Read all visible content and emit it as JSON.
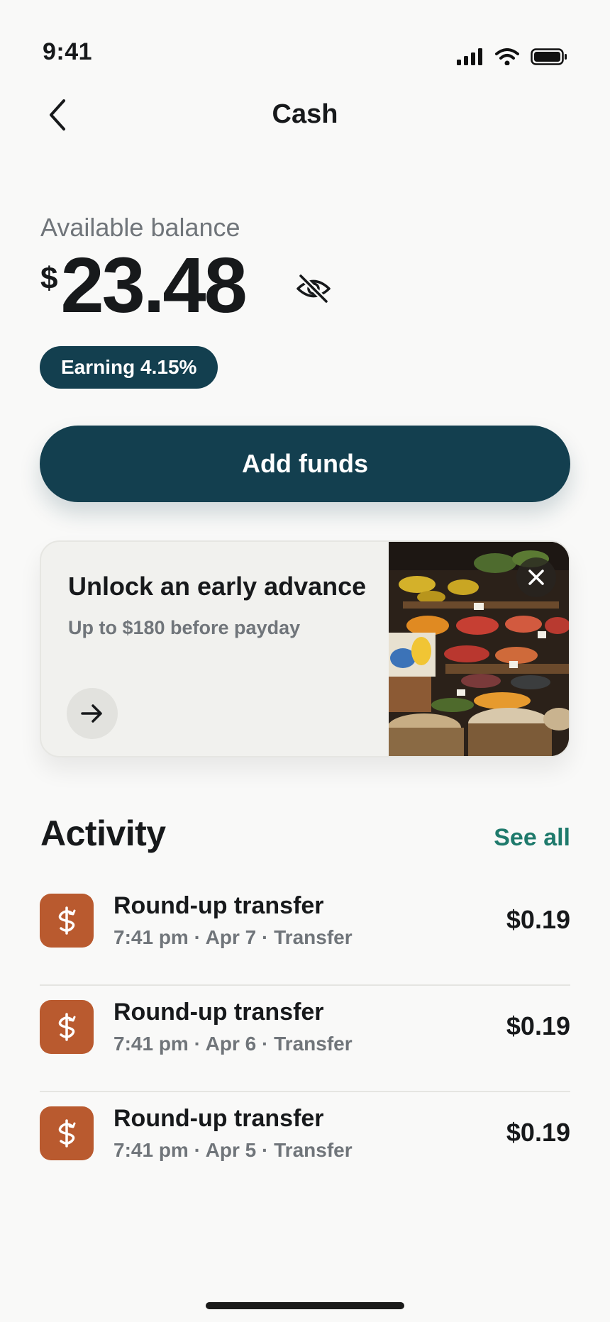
{
  "status_bar": {
    "time": "9:41",
    "icons": [
      "cellular-signal-icon",
      "wifi-icon",
      "battery-icon"
    ]
  },
  "nav": {
    "back_icon": "chevron-left-icon",
    "title": "Cash"
  },
  "balance": {
    "label": "Available balance",
    "currency_symbol": "$",
    "amount": "23.48",
    "hide_icon": "eye-off-icon"
  },
  "earning_badge": "Earning 4.15%",
  "add_funds_label": "Add funds",
  "promo": {
    "title": "Unlock an early advance",
    "subtitle": "Up to $180 before payday",
    "arrow_icon": "arrow-right-icon",
    "close_icon": "close-icon",
    "image": "market-produce-photo"
  },
  "activity": {
    "title": "Activity",
    "see_all": "See all",
    "items": [
      {
        "title": "Round-up transfer",
        "meta": "7:41 pm · Apr 7 · Transfer",
        "amount": "$0.19",
        "icon": "round-up-transfer-icon"
      },
      {
        "title": "Round-up transfer",
        "meta": "7:41 pm · Apr 6 · Transfer",
        "amount": "$0.19",
        "icon": "round-up-transfer-icon"
      },
      {
        "title": "Round-up transfer",
        "meta": "7:41 pm · Apr 5 · Transfer",
        "amount": "$0.19",
        "icon": "round-up-transfer-icon"
      }
    ]
  },
  "colors": {
    "primary": "#133f4f",
    "accent_link": "#1f7a6c",
    "transaction_icon_bg": "#b95a2f",
    "background": "#f9f9f8",
    "muted_text": "#70757a"
  }
}
